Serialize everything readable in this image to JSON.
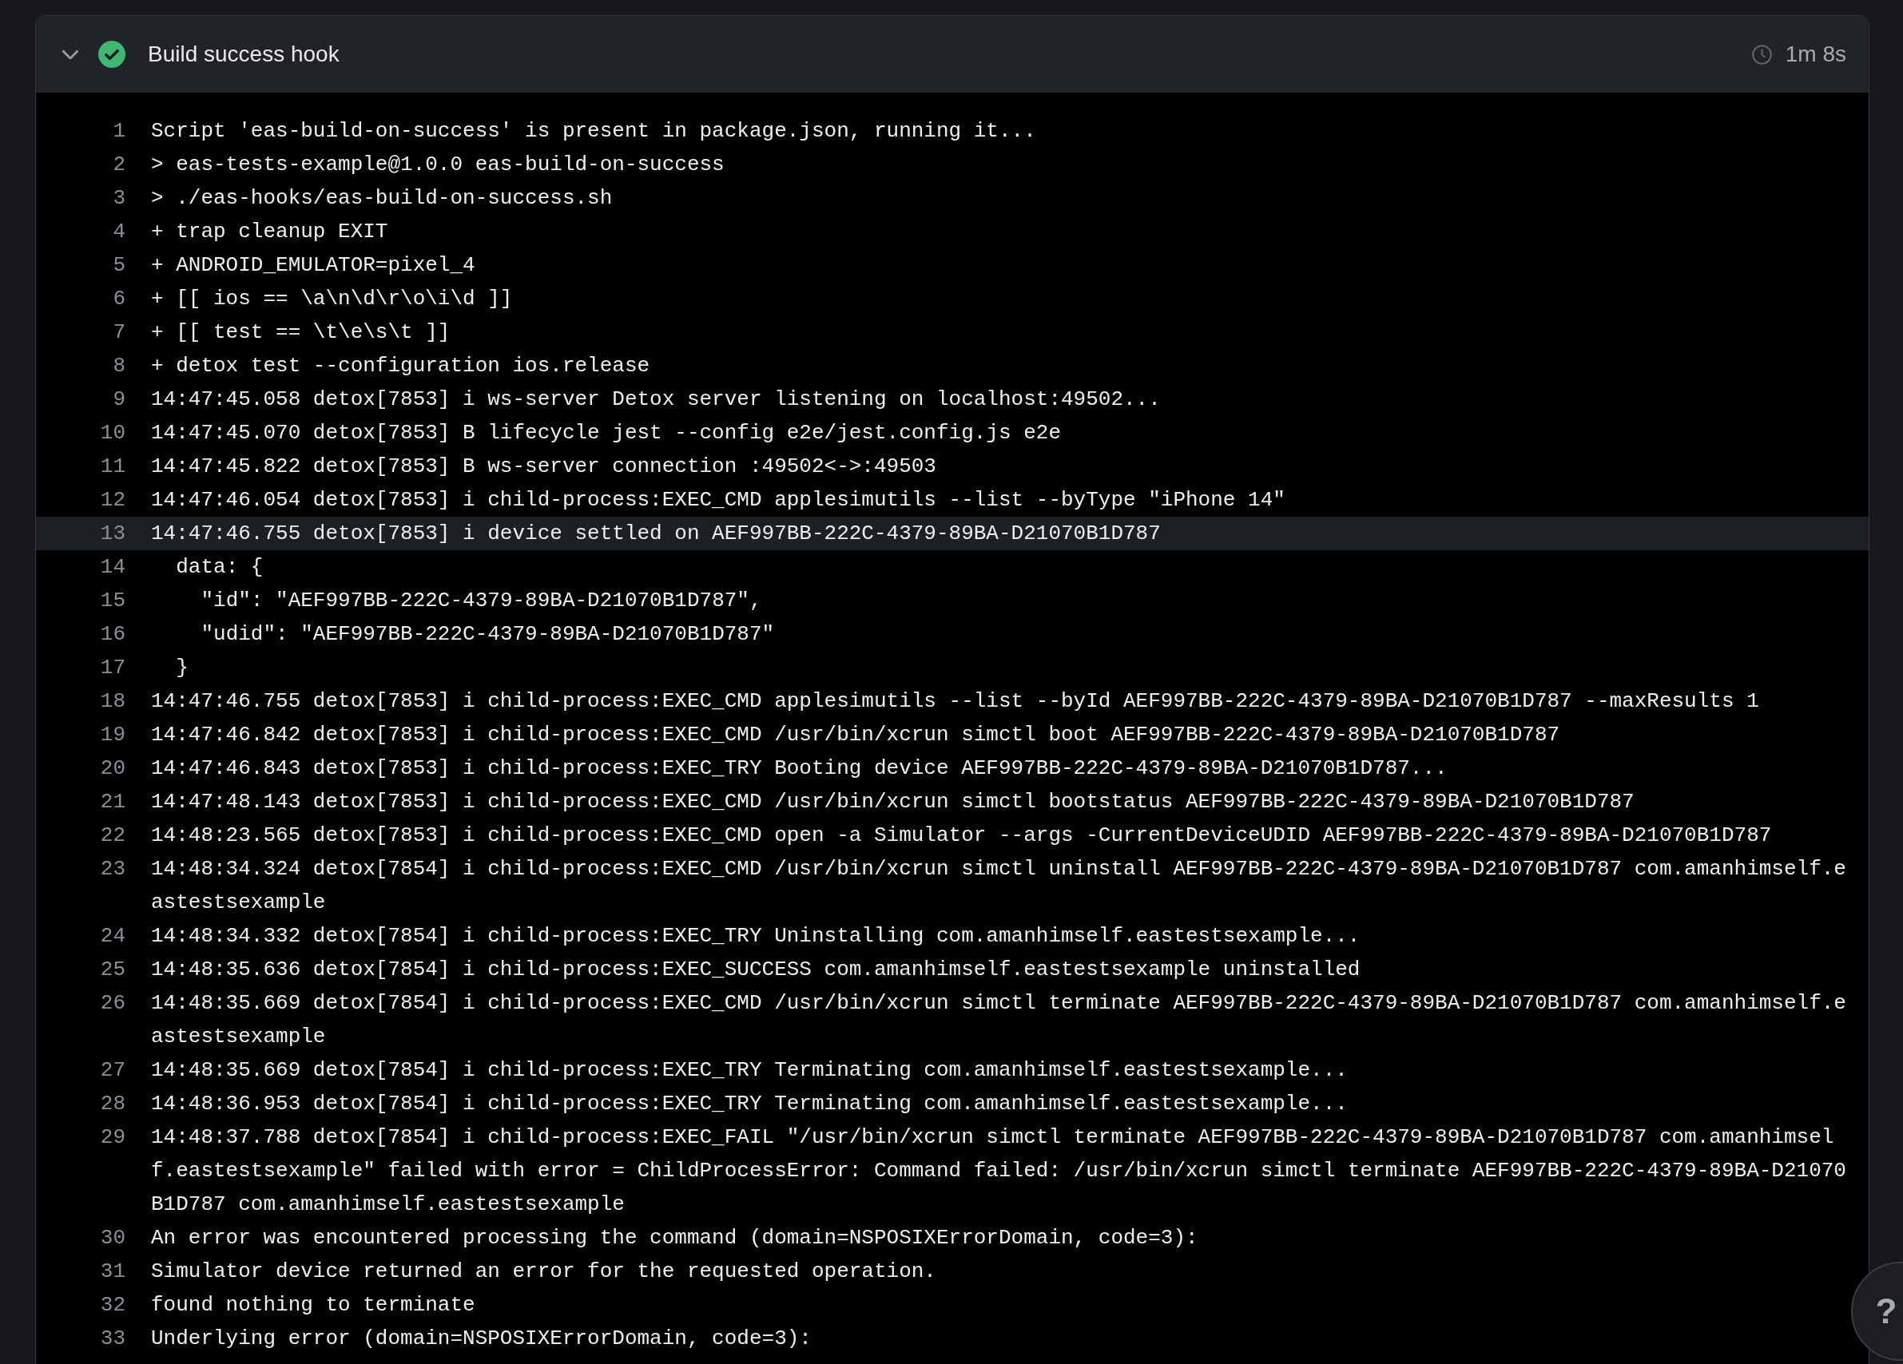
{
  "step": {
    "title": "Build success hook",
    "succeeded": true,
    "expanded": true,
    "duration": "1m 8s"
  },
  "log": {
    "lines": [
      {
        "number": "1",
        "text": "Script 'eas-build-on-success' is present in package.json, running it...",
        "highlighted": false
      },
      {
        "number": "2",
        "text": "> eas-tests-example@1.0.0 eas-build-on-success",
        "highlighted": false
      },
      {
        "number": "3",
        "text": "> ./eas-hooks/eas-build-on-success.sh",
        "highlighted": false
      },
      {
        "number": "4",
        "text": "+ trap cleanup EXIT",
        "highlighted": false
      },
      {
        "number": "5",
        "text": "+ ANDROID_EMULATOR=pixel_4",
        "highlighted": false
      },
      {
        "number": "6",
        "text": "+ [[ ios == \\a\\n\\d\\r\\o\\i\\d ]]",
        "highlighted": false
      },
      {
        "number": "7",
        "text": "+ [[ test == \\t\\e\\s\\t ]]",
        "highlighted": false
      },
      {
        "number": "8",
        "text": "+ detox test --configuration ios.release",
        "highlighted": false
      },
      {
        "number": "9",
        "text": "14:47:45.058 detox[7853] i ws-server Detox server listening on localhost:49502...",
        "highlighted": false
      },
      {
        "number": "10",
        "text": "14:47:45.070 detox[7853] B lifecycle jest --config e2e/jest.config.js e2e",
        "highlighted": false
      },
      {
        "number": "11",
        "text": "14:47:45.822 detox[7853] B ws-server connection :49502<->:49503",
        "highlighted": false
      },
      {
        "number": "12",
        "text": "14:47:46.054 detox[7853] i child-process:EXEC_CMD applesimutils --list --byType \"iPhone 14\"",
        "highlighted": false
      },
      {
        "number": "13",
        "text": "14:47:46.755 detox[7853] i device settled on AEF997BB-222C-4379-89BA-D21070B1D787",
        "highlighted": true
      },
      {
        "number": "14",
        "text": "  data: {",
        "highlighted": false
      },
      {
        "number": "15",
        "text": "    \"id\": \"AEF997BB-222C-4379-89BA-D21070B1D787\",",
        "highlighted": false
      },
      {
        "number": "16",
        "text": "    \"udid\": \"AEF997BB-222C-4379-89BA-D21070B1D787\"",
        "highlighted": false
      },
      {
        "number": "17",
        "text": "  }",
        "highlighted": false
      },
      {
        "number": "18",
        "text": "14:47:46.755 detox[7853] i child-process:EXEC_CMD applesimutils --list --byId AEF997BB-222C-4379-89BA-D21070B1D787 --maxResults 1",
        "highlighted": false
      },
      {
        "number": "19",
        "text": "14:47:46.842 detox[7853] i child-process:EXEC_CMD /usr/bin/xcrun simctl boot AEF997BB-222C-4379-89BA-D21070B1D787",
        "highlighted": false
      },
      {
        "number": "20",
        "text": "14:47:46.843 detox[7853] i child-process:EXEC_TRY Booting device AEF997BB-222C-4379-89BA-D21070B1D787...",
        "highlighted": false
      },
      {
        "number": "21",
        "text": "14:47:48.143 detox[7853] i child-process:EXEC_CMD /usr/bin/xcrun simctl bootstatus AEF997BB-222C-4379-89BA-D21070B1D787",
        "highlighted": false
      },
      {
        "number": "22",
        "text": "14:48:23.565 detox[7853] i child-process:EXEC_CMD open -a Simulator --args -CurrentDeviceUDID AEF997BB-222C-4379-89BA-D21070B1D787",
        "highlighted": false
      },
      {
        "number": "23",
        "text": "14:48:34.324 detox[7854] i child-process:EXEC_CMD /usr/bin/xcrun simctl uninstall AEF997BB-222C-4379-89BA-D21070B1D787 com.amanhimself.eastestsexample",
        "highlighted": false
      },
      {
        "number": "24",
        "text": "14:48:34.332 detox[7854] i child-process:EXEC_TRY Uninstalling com.amanhimself.eastestsexample...",
        "highlighted": false
      },
      {
        "number": "25",
        "text": "14:48:35.636 detox[7854] i child-process:EXEC_SUCCESS com.amanhimself.eastestsexample uninstalled",
        "highlighted": false
      },
      {
        "number": "26",
        "text": "14:48:35.669 detox[7854] i child-process:EXEC_CMD /usr/bin/xcrun simctl terminate AEF997BB-222C-4379-89BA-D21070B1D787 com.amanhimself.eastestsexample",
        "highlighted": false
      },
      {
        "number": "27",
        "text": "14:48:35.669 detox[7854] i child-process:EXEC_TRY Terminating com.amanhimself.eastestsexample...",
        "highlighted": false
      },
      {
        "number": "28",
        "text": "14:48:36.953 detox[7854] i child-process:EXEC_TRY Terminating com.amanhimself.eastestsexample...",
        "highlighted": false
      },
      {
        "number": "29",
        "text": "14:48:37.788 detox[7854] i child-process:EXEC_FAIL \"/usr/bin/xcrun simctl terminate AEF997BB-222C-4379-89BA-D21070B1D787 com.amanhimself.eastestsexample\" failed with error = ChildProcessError: Command failed: /usr/bin/xcrun simctl terminate AEF997BB-222C-4379-89BA-D21070B1D787 com.amanhimself.eastestsexample",
        "highlighted": false
      },
      {
        "number": "30",
        "text": "An error was encountered processing the command (domain=NSPOSIXErrorDomain, code=3):",
        "highlighted": false
      },
      {
        "number": "31",
        "text": "Simulator device returned an error for the requested operation.",
        "highlighted": false
      },
      {
        "number": "32",
        "text": "found nothing to terminate",
        "highlighted": false
      },
      {
        "number": "33",
        "text": "Underlying error (domain=NSPOSIXErrorDomain, code=3):",
        "highlighted": false
      }
    ]
  },
  "help_button": {
    "label": "?"
  }
}
